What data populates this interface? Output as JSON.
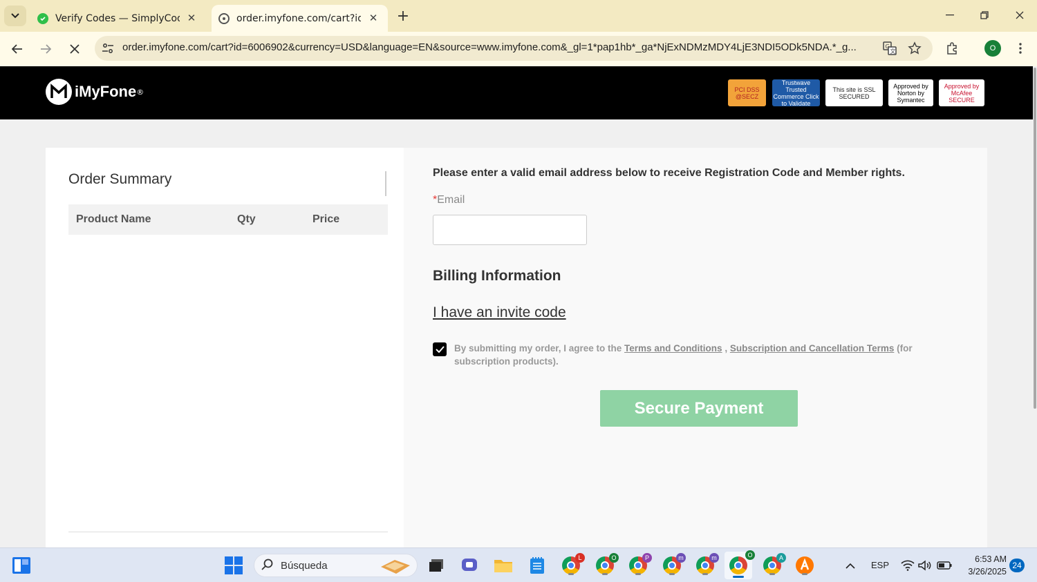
{
  "browser": {
    "tabs": [
      {
        "title": "Verify Codes — SimplyCodes",
        "active": false
      },
      {
        "title": "order.imyfone.com/cart?id=600",
        "active": true
      }
    ],
    "url": "order.imyfone.com/cart?id=6006902&currency=USD&language=EN&source=www.imyfone.com&_gl=1*pap1hb*_ga*NjExNDMzMDY4LjE3NDI5ODk5NDA.*_g...",
    "profile_initial": "O"
  },
  "site": {
    "logo_text": "iMyFone",
    "logo_reg": "®",
    "badges": [
      {
        "name": "pci-dss-badge",
        "text": "PCI DSS @SECZ",
        "bg": "#f2a33a",
        "fg": "#b22222"
      },
      {
        "name": "trustwave-badge",
        "text": "Trustwave Trusted Commerce Click to Validate",
        "bg": "#1f5aa6",
        "fg": "#ffffff"
      },
      {
        "name": "ssl-secured-badge",
        "text": "This site is SSL SECURED",
        "bg": "#ffffff",
        "fg": "#222222"
      },
      {
        "name": "norton-badge",
        "text": "Approved by Norton by Symantec",
        "bg": "#ffffff",
        "fg": "#000000"
      },
      {
        "name": "mcafee-badge",
        "text": "Approved by McAfee SECURE",
        "bg": "#ffffff",
        "fg": "#c8102e"
      }
    ]
  },
  "order_summary": {
    "title": "Order Summary",
    "columns": [
      "Product Name",
      "Qty",
      "Price"
    ]
  },
  "form": {
    "email_prompt": "Please enter a valid email address below to receive Registration Code and Member rights.",
    "email_required_mark": "*",
    "email_label": "Email",
    "email_value": "",
    "email_placeholder": "",
    "billing_title": "Billing Information",
    "invite_link": "I have an invite code",
    "agree_checked": true,
    "agree_prefix": "By submitting my order, I agree to the ",
    "terms_link": "Terms and Conditions",
    "agree_sep": " , ",
    "subscription_link": "Subscription and Cancellation Terms",
    "agree_suffix": " (for subscription products).",
    "submit_label": "Secure Payment",
    "submit_color": "#8fd3a4"
  },
  "taskbar": {
    "search_label": "Búsqueda",
    "language": "ESP",
    "time": "6:53 AM",
    "date": "3/26/2025",
    "notifications": "24",
    "chrome_profiles": [
      {
        "initial": "L",
        "color": "#d93025"
      },
      {
        "initial": "O",
        "color": "#188038"
      },
      {
        "initial": "P",
        "color": "#8e44ad"
      },
      {
        "initial": "m",
        "color": "#6c4fb6"
      },
      {
        "initial": "m",
        "color": "#6c4fb6"
      },
      {
        "initial": "O",
        "color": "#188038"
      },
      {
        "initial": "A",
        "color": "#1a9c9c"
      }
    ]
  }
}
